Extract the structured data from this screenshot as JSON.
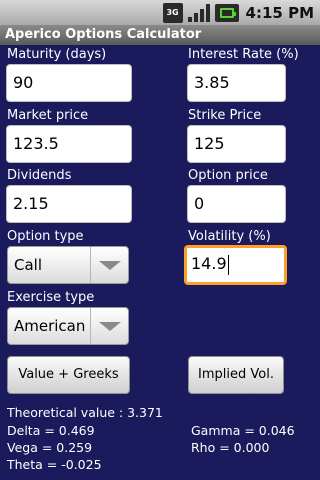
{
  "status": {
    "network": "3G",
    "time": "4:15 PM"
  },
  "app": {
    "title": "Aperico Options Calculator"
  },
  "fields": {
    "maturity": {
      "label": "Maturity (days)",
      "value": "90"
    },
    "interest_rate": {
      "label": "Interest Rate (%)",
      "value": "3.85"
    },
    "market_price": {
      "label": "Market price",
      "value": "123.5"
    },
    "strike_price": {
      "label": "Strike Price",
      "value": "125"
    },
    "dividends": {
      "label": "Dividends",
      "value": "2.15"
    },
    "option_price": {
      "label": "Option price",
      "value": "0"
    },
    "volatility": {
      "label": "Volatility (%)",
      "value": "14.9"
    }
  },
  "option_type": {
    "label": "Option type",
    "selected": "Call"
  },
  "exercise_type": {
    "label": "Exercise type",
    "selected": "American"
  },
  "buttons": {
    "value_greeks": "Value + Greeks",
    "implied_vol": "Implied Vol."
  },
  "results": {
    "theoretical_value": "Theoretical value : 3.371",
    "delta": "Delta = 0.469",
    "gamma": "Gamma = 0.046",
    "vega": "Vega = 0.259",
    "rho": "Rho = 0.000",
    "theta": "Theta = -0.025"
  }
}
